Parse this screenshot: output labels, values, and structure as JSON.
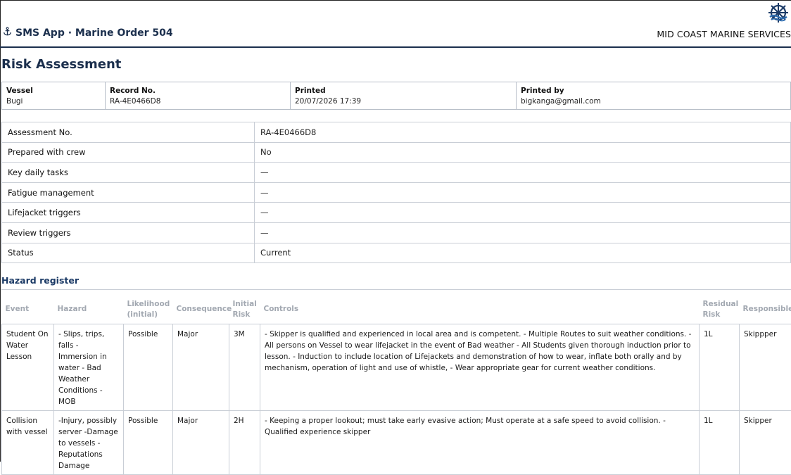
{
  "header": {
    "app_title": "SMS App · Marine Order 504",
    "company": "MID COAST MARINE SERVICES",
    "anchor_icon": "anchor-icon",
    "logo_icon": "ship-wheel-logo-icon",
    "brand_color": "#1b2f4d"
  },
  "page_title": "Risk Assessment",
  "meta": {
    "vessel_label": "Vessel",
    "vessel_value": "Bugi",
    "record_label": "Record No.",
    "record_value": "RA-4E0466D8",
    "printed_label": "Printed",
    "printed_value": "20/07/2026 17:39",
    "printed_by_label": "Printed by",
    "printed_by_value": "bigkanga@gmail.com"
  },
  "details": [
    {
      "label": "Assessment No.",
      "value": "RA-4E0466D8"
    },
    {
      "label": "Prepared with crew",
      "value": "No"
    },
    {
      "label": "Key daily tasks",
      "value": "—"
    },
    {
      "label": "Fatigue management",
      "value": "—"
    },
    {
      "label": "Lifejacket triggers",
      "value": "—"
    },
    {
      "label": "Review triggers",
      "value": "—"
    },
    {
      "label": "Status",
      "value": "Current"
    }
  ],
  "hazard_section_title": "Hazard register",
  "hazard_columns": {
    "event": "Event",
    "hazard": "Hazard",
    "likelihood_line1": "Likelihood",
    "likelihood_line2": "(initial)",
    "consequence": "Consequence",
    "initial_line1": "Initial",
    "initial_line2": "Risk",
    "controls": "Controls",
    "residual_line1": "Residual",
    "residual_line2": "Risk",
    "responsible": "Responsible"
  },
  "hazards": [
    {
      "event": "Student On Water Lesson",
      "hazard": "- Slips, trips, falls - Immersion in water - Bad Weather Conditions - MOB",
      "likelihood": "Possible",
      "consequence": "Major",
      "initial_risk": "3M",
      "controls": "- Skipper is qualified and experienced in local area and is competent. - Multiple Routes to suit weather conditions. - All persons on Vessel to wear lifejacket in the event of Bad weather - All Students given thorough induction prior to lesson. - Induction to include location of Lifejackets and demonstration of how to wear, inflate both orally and by mechanism, operation of light and use of whistle, - Wear appropriate gear for current weather conditions.",
      "residual_risk": "1L",
      "responsible": "Skippper"
    },
    {
      "event": "Collision with vessel",
      "hazard": "-Injury, possibly server -Damage to vessels - Reputations Damage",
      "likelihood": "Possible",
      "consequence": "Major",
      "initial_risk": "2H",
      "controls": "- Keeping a proper lookout; must take early evasive action; Must operate at a safe speed to avoid collision. - Qualified experience skipper",
      "residual_risk": "1L",
      "responsible": "Skipper"
    }
  ]
}
